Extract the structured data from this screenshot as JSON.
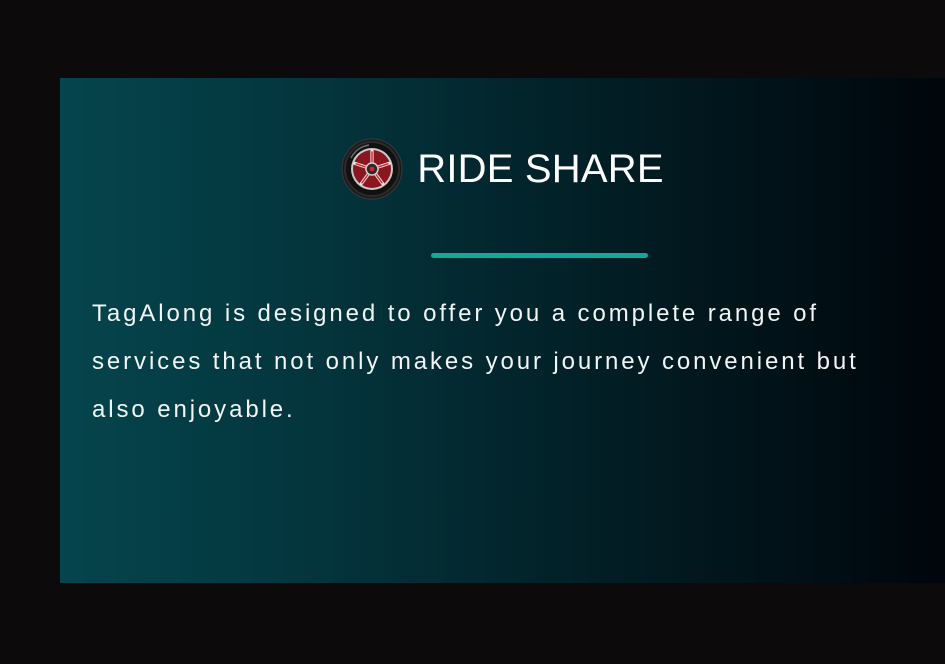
{
  "section": {
    "title": "RIDE SHARE",
    "icon": "car-wheel-icon",
    "description": "TagAlong is designed to offer you a complete range of services that not only makes your journey convenient but also enjoyable."
  },
  "colors": {
    "page_background": "#0c0a0a",
    "card_gradient_start": "#05454d",
    "card_gradient_end": "#00060b",
    "divider": "#14a89b",
    "text": "#ffffff",
    "wheel_rim": "#d81f2e"
  }
}
